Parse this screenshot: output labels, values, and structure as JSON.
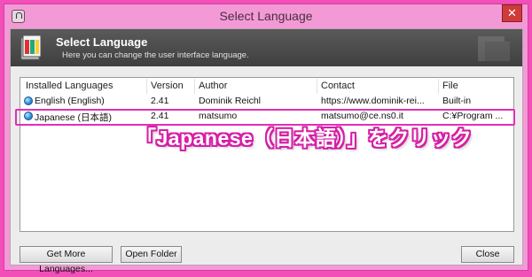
{
  "window": {
    "title": "Select Language",
    "close_glyph": "✕"
  },
  "banner": {
    "title": "Select Language",
    "subtitle": "Here you can change the user interface language.",
    "logo_icon": "language-book-icon"
  },
  "list": {
    "columns": [
      "Installed Languages",
      "Version",
      "Author",
      "Contact",
      "File"
    ],
    "rows": [
      {
        "name": "English (English)",
        "version": "2.41",
        "author": "Dominik Reichl",
        "contact": "https://www.dominik-rei...",
        "file": "Built-in",
        "icon": "globe-icon"
      },
      {
        "name": "Japanese (日本語)",
        "version": "2.41",
        "author": "matsumo",
        "contact": "matsumo@ce.ns0.it",
        "file": "C:¥Program ...",
        "icon": "globe-icon"
      }
    ]
  },
  "annotation": {
    "text": "「Japanese（日本語）」をクリック",
    "color": "#d61fa6"
  },
  "buttons": {
    "more": "Get More Languages...",
    "open": "Open Folder",
    "close": "Close"
  },
  "colors": {
    "frame": "#f24fb8",
    "highlight": "#e12fb6"
  }
}
